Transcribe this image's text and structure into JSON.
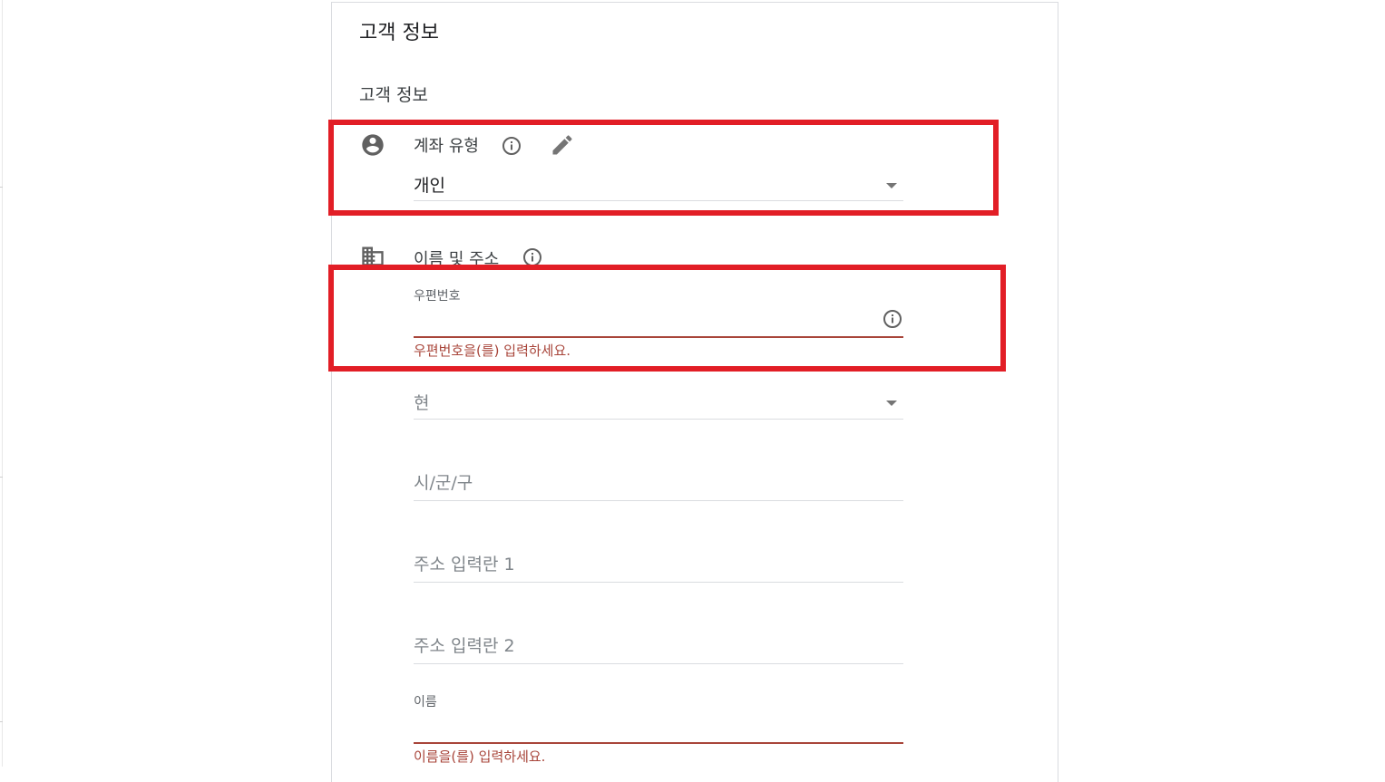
{
  "page": {
    "title": "고객 정보",
    "section_subtitle": "고객 정보"
  },
  "account_type": {
    "label": "계좌 유형",
    "value": "개인",
    "icon": "account-circle-icon"
  },
  "name_address": {
    "label": "이름 및 주소",
    "icon": "business-building-icon",
    "postal_code": {
      "label": "우편번호",
      "value": "",
      "error": "우편번호을(를) 입력하세요."
    },
    "prefecture": {
      "placeholder": "현"
    },
    "city": {
      "placeholder": "시/군/구"
    },
    "address1": {
      "placeholder": "주소 입력란 1"
    },
    "address2": {
      "placeholder": "주소 입력란 2"
    },
    "name": {
      "label": "이름",
      "value": "",
      "error": "이름을(를) 입력하세요."
    }
  },
  "colors": {
    "highlight": "#e21e26",
    "error": "#a8453a",
    "icon": "#616161"
  }
}
